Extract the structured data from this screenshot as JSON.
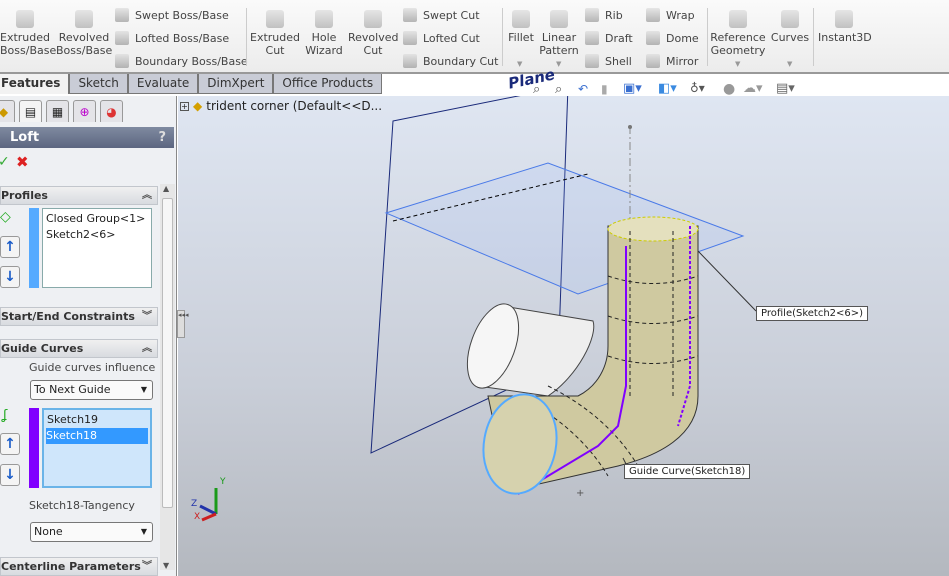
{
  "toolbar": {
    "big": [
      {
        "label": "Extruded Boss/Base"
      },
      {
        "label": "Revolved Boss/Base"
      },
      {
        "label": "Extruded Cut"
      },
      {
        "label": "Hole Wizard"
      },
      {
        "label": "Revolved Cut"
      },
      {
        "label": "Fillet"
      },
      {
        "label": "Linear Pattern"
      },
      {
        "label": "Reference Geometry"
      },
      {
        "label": "Curves"
      },
      {
        "label": "Instant3D"
      }
    ],
    "small": [
      {
        "label": "Swept Boss/Base"
      },
      {
        "label": "Lofted Boss/Base"
      },
      {
        "label": "Boundary Boss/Base"
      },
      {
        "label": "Swept Cut"
      },
      {
        "label": "Lofted Cut"
      },
      {
        "label": "Boundary Cut"
      },
      {
        "label": "Rib"
      },
      {
        "label": "Draft"
      },
      {
        "label": "Shell"
      },
      {
        "label": "Wrap"
      },
      {
        "label": "Dome"
      },
      {
        "label": "Mirror"
      }
    ]
  },
  "tabs": [
    {
      "label": "Features",
      "active": true
    },
    {
      "label": "Sketch"
    },
    {
      "label": "Evaluate"
    },
    {
      "label": "DimXpert"
    },
    {
      "label": "Office Products"
    }
  ],
  "tree": {
    "root": "trident corner  (Default<<D..."
  },
  "panel": {
    "title": "Loft",
    "help": "?",
    "ok_icon": "check-icon",
    "cancel_icon": "x-icon",
    "profiles": {
      "label": "Profiles",
      "items": [
        "Closed Group<1>",
        "Sketch2<6>"
      ],
      "color": "#55aaff"
    },
    "start_end": {
      "label": "Start/End Constraints"
    },
    "guides": {
      "label": "Guide Curves",
      "influence_label": "Guide curves influence",
      "influence_value": "To Next Guide",
      "items": [
        "Sketch19",
        "Sketch18"
      ],
      "selected": "Sketch18",
      "color": "#8000ff",
      "tangency_label": "Sketch18-Tangency",
      "tangency_value": "None"
    },
    "centerline": {
      "label": "Centerline Parameters"
    }
  },
  "viewport": {
    "plane_label": "Plane",
    "callouts": {
      "profile": "Profile(Sketch2<6>)",
      "guide": "Guide Curve(Sketch18)"
    },
    "axes": {
      "x": "X",
      "y": "Y",
      "z": "Z"
    }
  }
}
